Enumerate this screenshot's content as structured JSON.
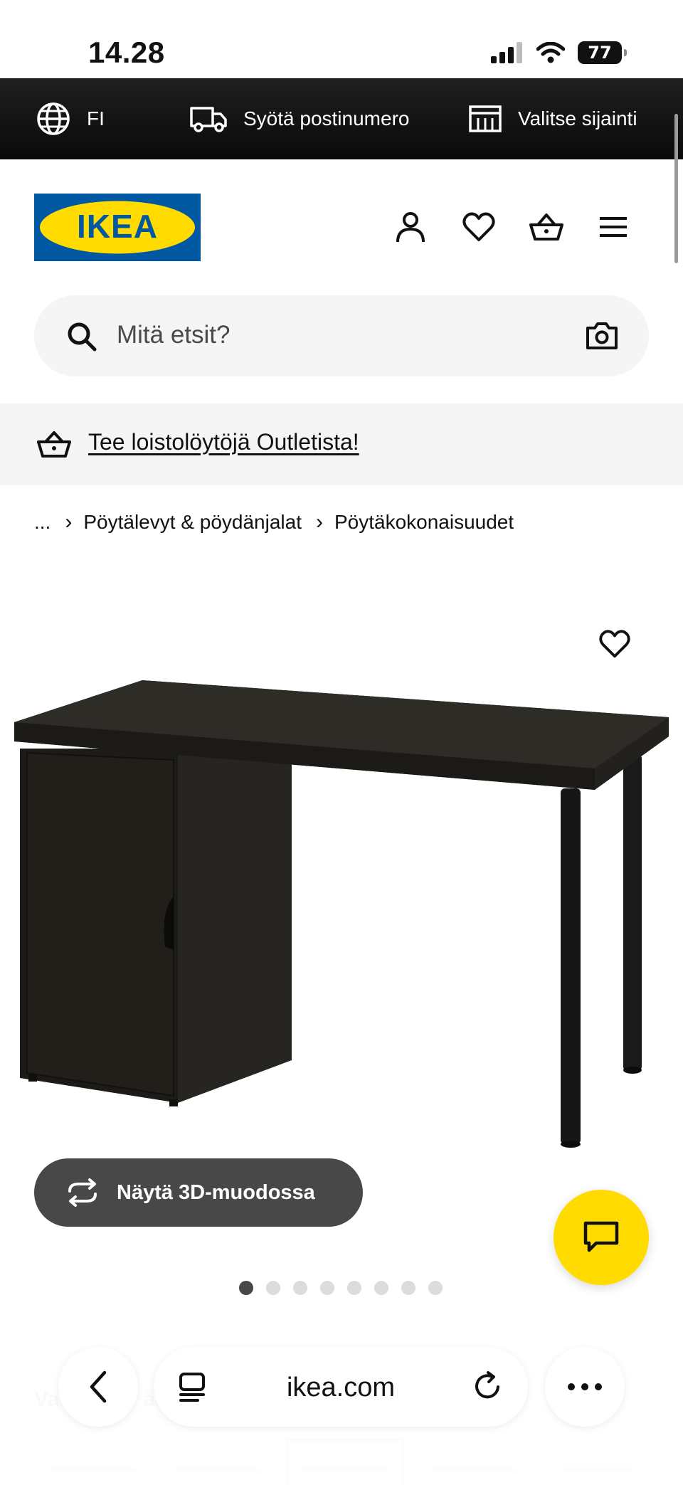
{
  "status_bar": {
    "time": "14.28",
    "battery": "77"
  },
  "top_bar": {
    "language": "FI",
    "postal_code": "Syötä postinumero",
    "location": "Valitse sijainti"
  },
  "header": {
    "logo_text": "IKEA"
  },
  "search": {
    "placeholder": "Mitä etsit?"
  },
  "banner": {
    "text": "Tee loistolöytöjä Outletista!"
  },
  "breadcrumb": {
    "ellipsis": "...",
    "items": [
      "Pöytälevyt & pöydänjalat",
      "Pöytäkokonaisuudet"
    ],
    "separator": "›"
  },
  "product": {
    "button_3d": "Näytä 3D-muodossa",
    "image_count": 8,
    "active_image": 1
  },
  "below_fold": {
    "partial_label": "Va",
    "partial_label_2": "är"
  },
  "browser": {
    "url": "ikea.com"
  },
  "colors": {
    "ikea_blue": "#0058a3",
    "ikea_yellow": "#ffdb00",
    "top_bar": "#111111",
    "button_dark": "#484848"
  }
}
